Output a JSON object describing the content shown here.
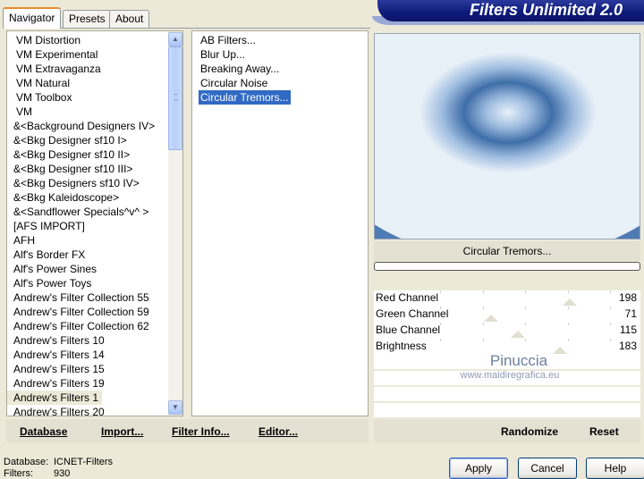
{
  "tabs": [
    "Navigator",
    "Presets",
    "About"
  ],
  "banner_title": "Filters Unlimited 2.0",
  "categories": [
    "VM Distortion",
    "VM Experimental",
    "VM Extravaganza",
    "VM Natural",
    "VM Toolbox",
    "VM",
    "&<Background Designers IV>",
    "&<Bkg Designer sf10 I>",
    "&<Bkg Designer sf10 II>",
    "&<Bkg Designer sf10 III>",
    "&<Bkg Designers sf10 IV>",
    "&<Bkg Kaleidoscope>",
    "&<Sandflower Specials^v^ >",
    "[AFS IMPORT]",
    "AFH",
    "Alf's Border FX",
    "Alf's Power Sines",
    "Alf's Power Toys",
    "Andrew's Filter Collection 55",
    "Andrew's Filter Collection 59",
    "Andrew's Filter Collection 62",
    "Andrew's Filters 10",
    "Andrew's Filters 14",
    "Andrew's Filters 15",
    "Andrew's Filters 19",
    "Andrew's Filters 1",
    "Andrew's Filters 20"
  ],
  "filters": [
    "AB Filters...",
    "Blur Up...",
    "Breaking Away...",
    "Circular Noise",
    "Circular Tremors..."
  ],
  "preview": {
    "filter_name": "Circular Tremors..."
  },
  "channels": [
    {
      "label": "Red Channel",
      "value": "198"
    },
    {
      "label": "Green Channel",
      "value": "71"
    },
    {
      "label": "Blue Channel",
      "value": "115"
    },
    {
      "label": "Brightness",
      "value": "183"
    }
  ],
  "watermark": {
    "name": "Pinuccia",
    "url": "www.maidiregrafica.eu"
  },
  "left_buttons": {
    "database": "Database",
    "import": "Import...",
    "filter_info": "Filter Info...",
    "editor": "Editor..."
  },
  "right_buttons": {
    "randomize": "Randomize",
    "reset": "Reset"
  },
  "status": {
    "database_label": "Database:",
    "database_value": "ICNET-Filters",
    "filters_label": "Filters:",
    "filters_value": "930"
  },
  "dialog_buttons": {
    "apply": "Apply",
    "cancel": "Cancel",
    "help": "Help"
  },
  "colors": {
    "accent": "#316ac5",
    "banner": "#0d1a78",
    "preview_light": "#dce8f5",
    "preview_dark": "#2f5f9d"
  }
}
